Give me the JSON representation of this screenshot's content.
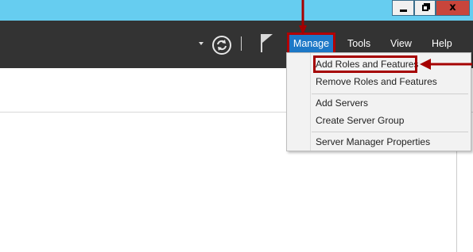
{
  "toolbar": {
    "menu": {
      "manage": "Manage",
      "tools": "Tools",
      "view": "View",
      "help": "Help"
    }
  },
  "manage_menu": {
    "items": [
      "Add Roles and Features",
      "Remove Roles and Features",
      "Add Servers",
      "Create Server Group",
      "Server Manager Properties"
    ],
    "highlighted_item": "Add Roles and Features"
  },
  "window_controls": {
    "close_glyph": "x"
  },
  "colors": {
    "titlebar": "#66cdf0",
    "toolbar": "#333333",
    "menu_active": "#1d78c7",
    "annotation_red": "#b30000",
    "dropdown_bg": "#f2f2f2"
  },
  "icons": [
    "minimize-icon",
    "maximize-icon",
    "close-icon",
    "dropdown-arrow-icon",
    "refresh-icon",
    "flag-icon",
    "annotation-arrow-down",
    "annotation-arrow-left"
  ]
}
